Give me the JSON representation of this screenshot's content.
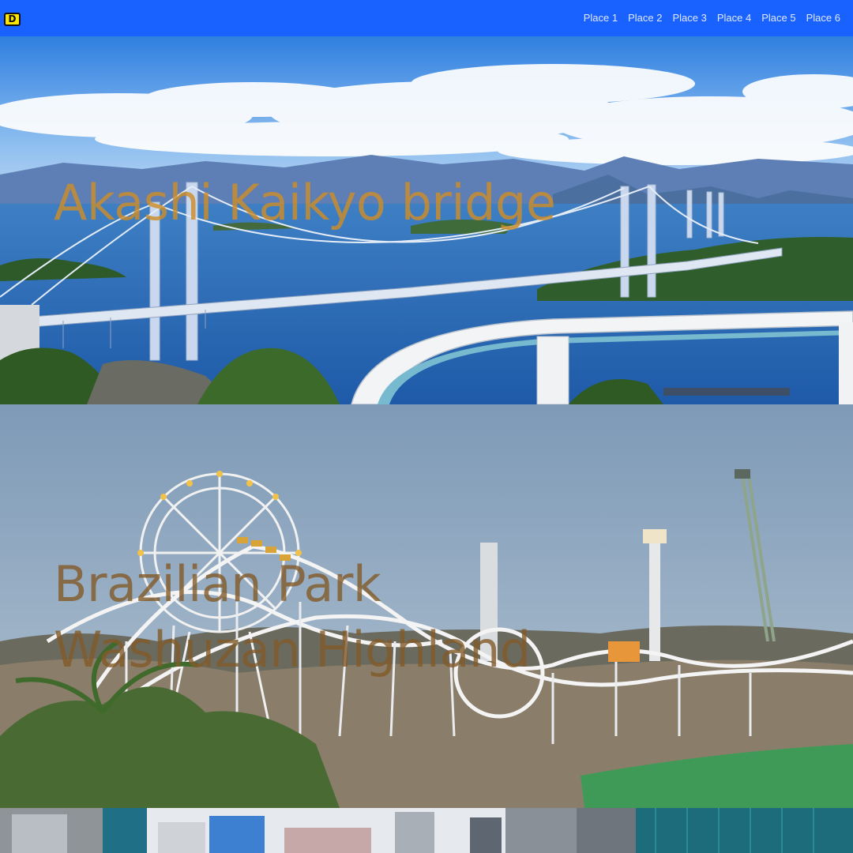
{
  "header": {
    "logo_text": "D",
    "logo_color": "#ffe600",
    "bar_color": "#1a62ff",
    "nav": [
      {
        "label": "Place 1"
      },
      {
        "label": "Place 2"
      },
      {
        "label": "Place 3"
      },
      {
        "label": "Place 4"
      },
      {
        "label": "Place 5"
      },
      {
        "label": "Place 6"
      }
    ]
  },
  "places": [
    {
      "title": "Akashi Kaikyo bridge",
      "title_color": "#cd8c28"
    },
    {
      "title": "Brazilian Park Washuzan Highland",
      "title_color": "#825a28"
    },
    {
      "title": ""
    }
  ]
}
